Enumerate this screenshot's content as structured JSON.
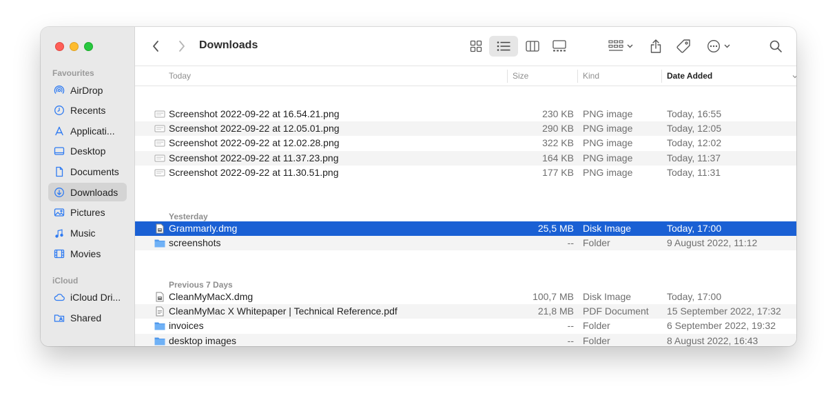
{
  "window": {
    "title": "Downloads"
  },
  "sidebar": {
    "favourites_heading": "Favourites",
    "favourites": [
      {
        "label": "AirDrop",
        "icon": "airdrop-icon"
      },
      {
        "label": "Recents",
        "icon": "clock-icon"
      },
      {
        "label": "Applicati...",
        "icon": "applications-icon"
      },
      {
        "label": "Desktop",
        "icon": "desktop-icon"
      },
      {
        "label": "Documents",
        "icon": "document-icon"
      },
      {
        "label": "Downloads",
        "icon": "download-icon",
        "active": true
      },
      {
        "label": "Pictures",
        "icon": "pictures-icon"
      },
      {
        "label": "Music",
        "icon": "music-icon"
      },
      {
        "label": "Movies",
        "icon": "film-icon"
      }
    ],
    "icloud_heading": "iCloud",
    "icloud": [
      {
        "label": "iCloud Dri...",
        "icon": "cloud-icon"
      },
      {
        "label": "Shared",
        "icon": "shared-folder-icon"
      }
    ]
  },
  "columns": {
    "name": "Today",
    "size": "Size",
    "kind": "Kind",
    "date": "Date Added"
  },
  "groups": [
    {
      "label": "Today",
      "files": [
        {
          "name": "Screenshot 2022-09-22 at 16.54.21.png",
          "size": "230 KB",
          "kind": "PNG image",
          "date": "Today, 16:55",
          "type": "image"
        },
        {
          "name": "Screenshot 2022-09-22 at 12.05.01.png",
          "size": "290 KB",
          "kind": "PNG image",
          "date": "Today, 12:05",
          "type": "image"
        },
        {
          "name": "Screenshot 2022-09-22 at 12.02.28.png",
          "size": "322 KB",
          "kind": "PNG image",
          "date": "Today, 12:02",
          "type": "image"
        },
        {
          "name": "Screenshot 2022-09-22 at 11.37.23.png",
          "size": "164 KB",
          "kind": "PNG image",
          "date": "Today, 11:37",
          "type": "image"
        },
        {
          "name": "Screenshot 2022-09-22 at 11.30.51.png",
          "size": "177 KB",
          "kind": "PNG image",
          "date": "Today, 11:31",
          "type": "image"
        }
      ]
    },
    {
      "label": "Yesterday",
      "files": [
        {
          "name": "Grammarly.dmg",
          "size": "25,5 MB",
          "kind": "Disk Image",
          "date": "Today, 17:00",
          "type": "disk",
          "selected": true
        },
        {
          "name": "screenshots",
          "size": "--",
          "kind": "Folder",
          "date": "9 August 2022, 11:12",
          "type": "folder"
        }
      ]
    },
    {
      "label": "Previous 7 Days",
      "files": [
        {
          "name": "CleanMyMacX.dmg",
          "size": "100,7 MB",
          "kind": "Disk Image",
          "date": "Today, 17:00",
          "type": "disk"
        },
        {
          "name": "CleanMyMac X Whitepaper | Technical Reference.pdf",
          "size": "21,8 MB",
          "kind": "PDF Document",
          "date": "15 September 2022, 17:32",
          "type": "pdf"
        },
        {
          "name": "invoices",
          "size": "--",
          "kind": "Folder",
          "date": "6 September 2022, 19:32",
          "type": "folder"
        },
        {
          "name": "desktop images",
          "size": "--",
          "kind": "Folder",
          "date": "8 August 2022, 16:43",
          "type": "folder"
        }
      ]
    }
  ],
  "colors": {
    "selection": "#1a60d4",
    "folder": "#5aa0f0",
    "accent": "#1a60d4"
  }
}
